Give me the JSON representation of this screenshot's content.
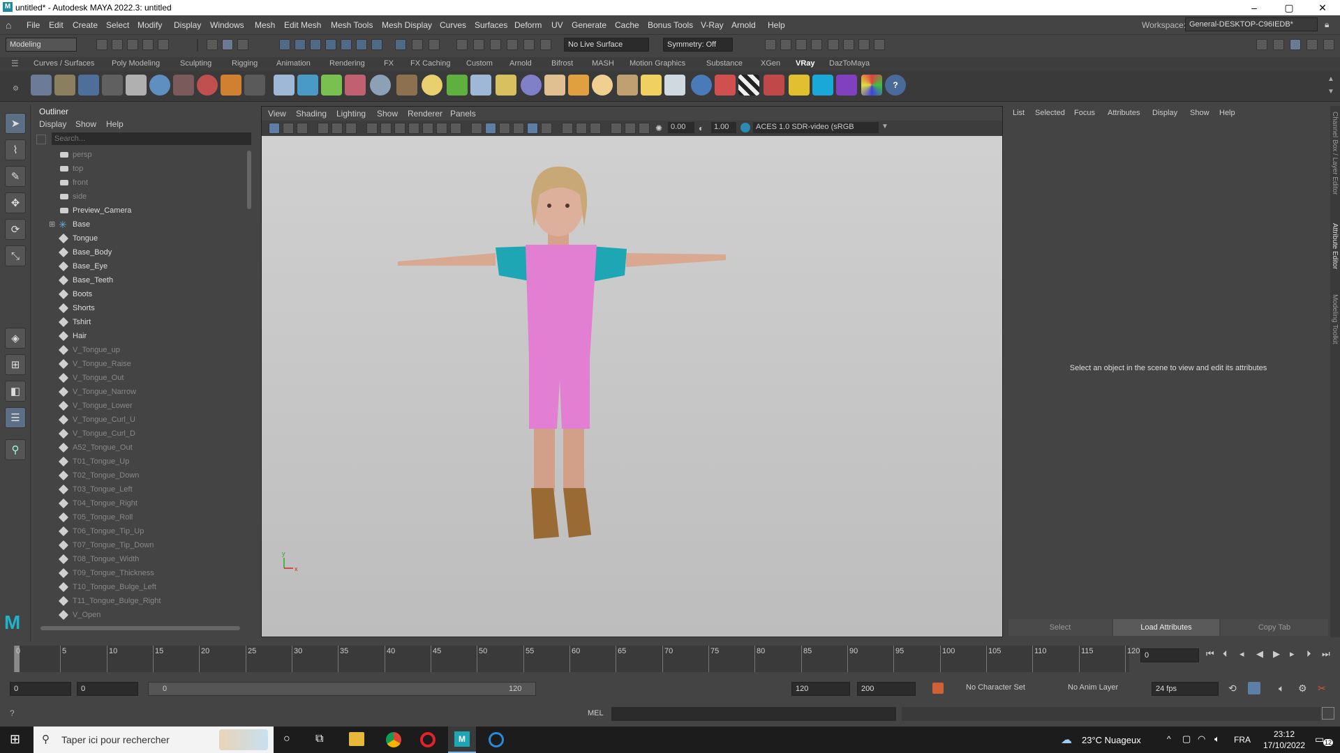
{
  "window": {
    "title": "untitled* - Autodesk MAYA 2022.3: untitled",
    "minimize": "–",
    "maximize": "▢",
    "close": "✕"
  },
  "menubar": {
    "items": [
      "File",
      "Edit",
      "Create",
      "Select",
      "Modify",
      "Display",
      "Windows",
      "Mesh",
      "Edit Mesh",
      "Mesh Tools",
      "Mesh Display",
      "Curves",
      "Surfaces",
      "Deform",
      "UV",
      "Generate",
      "Cache",
      "Bonus Tools",
      "V-Ray",
      "Arnold",
      "Help"
    ],
    "workspace_label": "Workspace:",
    "workspace_value": "General-DESKTOP-C96IEDB*"
  },
  "toolbar": {
    "mode": "Modeling",
    "live_surface": "No Live Surface",
    "symmetry": "Symmetry: Off"
  },
  "shelf": {
    "tabs": [
      "Curves / Surfaces",
      "Poly Modeling",
      "Sculpting",
      "Rigging",
      "Animation",
      "Rendering",
      "FX",
      "FX Caching",
      "Custom",
      "Arnold",
      "Bifrost",
      "MASH",
      "Motion Graphics",
      "Substance",
      "XGen",
      "VRay",
      "DazToMaya"
    ],
    "active": "VRay"
  },
  "outliner": {
    "title": "Outliner",
    "menus": [
      "Display",
      "Show",
      "Help"
    ],
    "search_placeholder": "Search...",
    "items": [
      {
        "label": "persp",
        "dim": true,
        "kind": "camera"
      },
      {
        "label": "top",
        "dim": true,
        "kind": "camera"
      },
      {
        "label": "front",
        "dim": true,
        "kind": "camera"
      },
      {
        "label": "side",
        "dim": true,
        "kind": "camera"
      },
      {
        "label": "Preview_Camera",
        "dim": false,
        "kind": "camera"
      },
      {
        "label": "Base",
        "dim": false,
        "kind": "joint"
      },
      {
        "label": "Tongue",
        "dim": false,
        "kind": "mesh"
      },
      {
        "label": "Base_Body",
        "dim": false,
        "kind": "mesh"
      },
      {
        "label": "Base_Eye",
        "dim": false,
        "kind": "mesh"
      },
      {
        "label": "Base_Teeth",
        "dim": false,
        "kind": "mesh"
      },
      {
        "label": "Boots",
        "dim": false,
        "kind": "mesh"
      },
      {
        "label": "Shorts",
        "dim": false,
        "kind": "mesh"
      },
      {
        "label": "Tshirt",
        "dim": false,
        "kind": "mesh"
      },
      {
        "label": "Hair",
        "dim": false,
        "kind": "mesh"
      },
      {
        "label": "V_Tongue_up",
        "dim": true,
        "kind": "mesh"
      },
      {
        "label": "V_Tongue_Raise",
        "dim": true,
        "kind": "mesh"
      },
      {
        "label": "V_Tongue_Out",
        "dim": true,
        "kind": "mesh"
      },
      {
        "label": "V_Tongue_Narrow",
        "dim": true,
        "kind": "mesh"
      },
      {
        "label": "V_Tongue_Lower",
        "dim": true,
        "kind": "mesh"
      },
      {
        "label": "V_Tongue_Curl_U",
        "dim": true,
        "kind": "mesh"
      },
      {
        "label": "V_Tongue_Curl_D",
        "dim": true,
        "kind": "mesh"
      },
      {
        "label": "A52_Tongue_Out",
        "dim": true,
        "kind": "mesh"
      },
      {
        "label": "T01_Tongue_Up",
        "dim": true,
        "kind": "mesh"
      },
      {
        "label": "T02_Tongue_Down",
        "dim": true,
        "kind": "mesh"
      },
      {
        "label": "T03_Tongue_Left",
        "dim": true,
        "kind": "mesh"
      },
      {
        "label": "T04_Tongue_Right",
        "dim": true,
        "kind": "mesh"
      },
      {
        "label": "T05_Tongue_Roll",
        "dim": true,
        "kind": "mesh"
      },
      {
        "label": "T06_Tongue_Tip_Up",
        "dim": true,
        "kind": "mesh"
      },
      {
        "label": "T07_Tongue_Tip_Down",
        "dim": true,
        "kind": "mesh"
      },
      {
        "label": "T08_Tongue_Width",
        "dim": true,
        "kind": "mesh"
      },
      {
        "label": "T09_Tongue_Thickness",
        "dim": true,
        "kind": "mesh"
      },
      {
        "label": "T10_Tongue_Bulge_Left",
        "dim": true,
        "kind": "mesh"
      },
      {
        "label": "T11_Tongue_Bulge_Right",
        "dim": true,
        "kind": "mesh"
      },
      {
        "label": "V_Open",
        "dim": true,
        "kind": "mesh"
      }
    ]
  },
  "viewport": {
    "menus": [
      "View",
      "Shading",
      "Lighting",
      "Show",
      "Renderer",
      "Panels"
    ],
    "exposure": "0.00",
    "gamma": "1.00",
    "colorspace": "ACES 1.0 SDR-video (sRGB",
    "axis_x": "x",
    "axis_y": "y"
  },
  "attribute_editor": {
    "menus": [
      "List",
      "Selected",
      "Focus",
      "Attributes",
      "Display",
      "Show",
      "Help"
    ],
    "message": "Select an object in the scene to view and edit its attributes",
    "buttons": [
      "Select",
      "Load Attributes",
      "Copy Tab"
    ]
  },
  "side_tabs": [
    "Channel Box / Layer Editor",
    "Attribute Editor",
    "Modeling Toolkit"
  ],
  "timeline": {
    "ticks": [
      "0",
      "5",
      "10",
      "15",
      "20",
      "25",
      "30",
      "35",
      "40",
      "45",
      "50",
      "55",
      "60",
      "65",
      "70",
      "75",
      "80",
      "85",
      "90",
      "95",
      "100",
      "105",
      "110",
      "115",
      "120"
    ],
    "current_frame": "0"
  },
  "range": {
    "start": "0",
    "anim_start": "0",
    "slider_start": "0",
    "slider_end": "120",
    "end": "120",
    "anim_end": "200",
    "character_set": "No Character Set",
    "anim_layer": "No Anim Layer",
    "fps": "24 fps"
  },
  "command": {
    "lang": "MEL"
  },
  "taskbar": {
    "search": "Taper ici pour rechercher",
    "weather": "23°C  Nuageux",
    "lang": "FRA",
    "time": "23:12",
    "date": "17/10/2022",
    "notif": "12"
  },
  "colors": {
    "maya_accent": "#1f8a9e",
    "active_tool": "#5d6f85",
    "viewport_bg": "#c8c8c8"
  }
}
